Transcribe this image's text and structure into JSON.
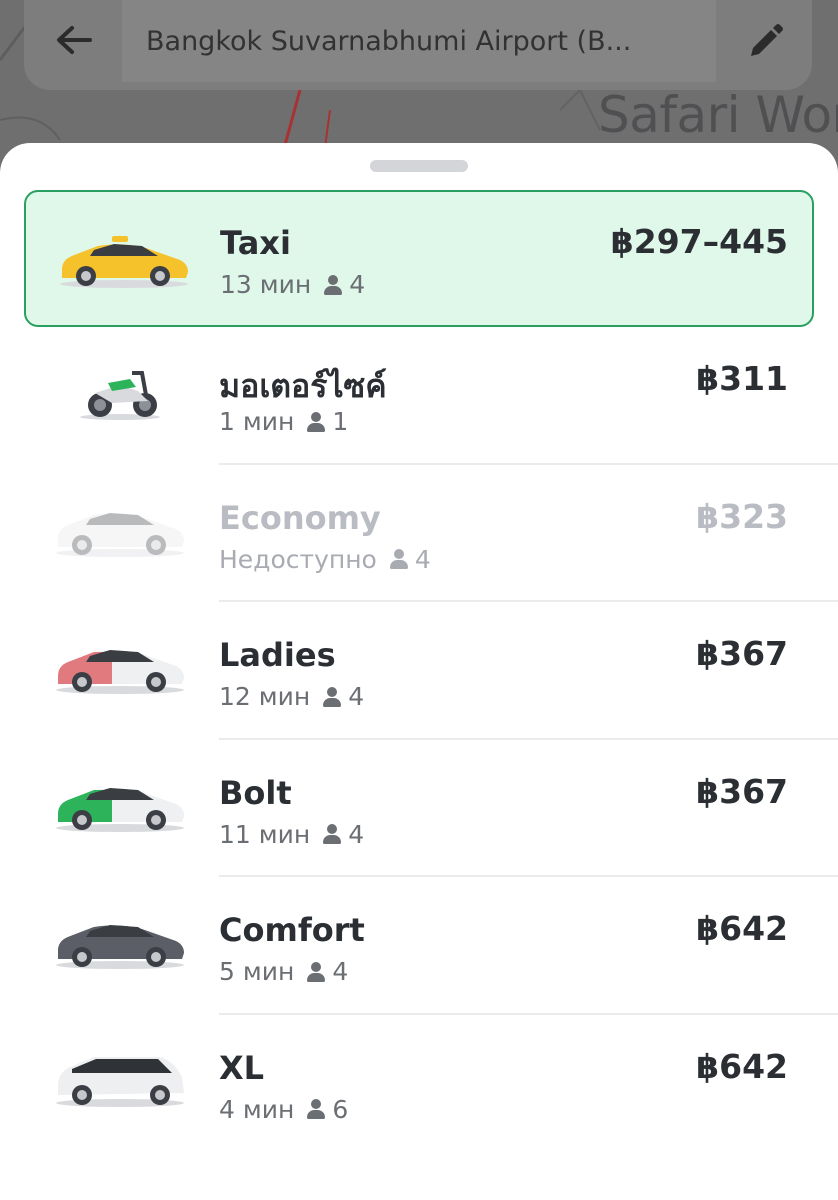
{
  "map": {
    "label": "Safari Wor"
  },
  "search": {
    "destination": "Bangkok Suvarnabhumi Airport (B..."
  },
  "options": [
    {
      "name": "Taxi",
      "eta": "13 мин",
      "seats": "4",
      "price": "฿297–445",
      "vehicle": "taxi-car",
      "color": "#f6c22b",
      "selected": true
    },
    {
      "name": "มอเตอร์ไซค์",
      "eta": "1 мин",
      "seats": "1",
      "price": "฿311",
      "vehicle": "motorbike",
      "color": "#2db45a"
    },
    {
      "name": "Economy",
      "eta": "Недоступно",
      "seats": "4",
      "price": "฿323",
      "vehicle": "economy-car",
      "color": "#e6e7ea",
      "disabled": true
    },
    {
      "name": "Ladies",
      "eta": "12 мин",
      "seats": "4",
      "price": "฿367",
      "vehicle": "ladies-car",
      "color": "#e07a7f"
    },
    {
      "name": "Bolt",
      "eta": "11 мин",
      "seats": "4",
      "price": "฿367",
      "vehicle": "bolt-car",
      "color": "#2db45a"
    },
    {
      "name": "Comfort",
      "eta": "5 мин",
      "seats": "4",
      "price": "฿642",
      "vehicle": "comfort-car",
      "color": "#5b5e66"
    },
    {
      "name": "XL",
      "eta": "4 мин",
      "seats": "6",
      "price": "฿642",
      "vehicle": "xl-van",
      "color": "#eeeff1"
    }
  ]
}
